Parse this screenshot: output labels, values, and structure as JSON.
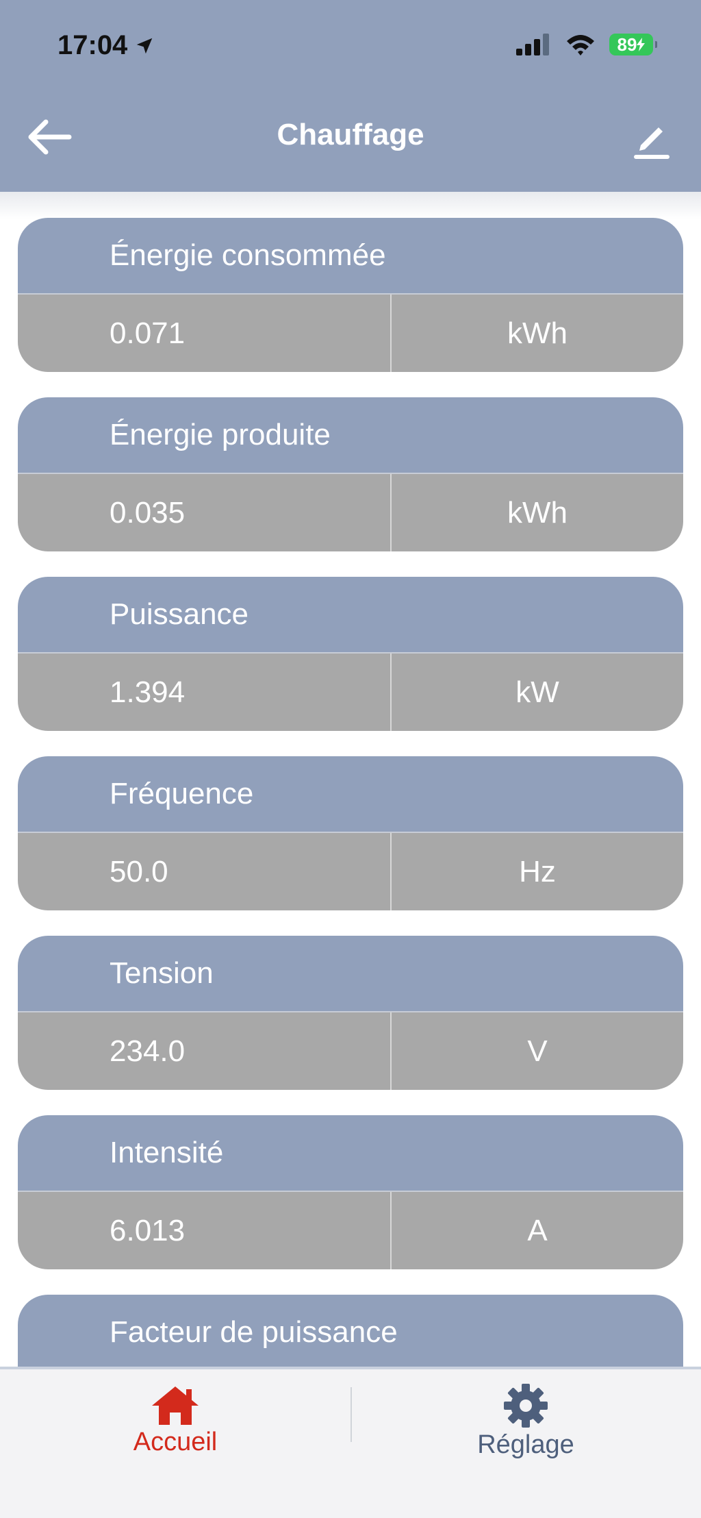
{
  "status": {
    "time": "17:04",
    "battery": "89"
  },
  "nav": {
    "title": "Chauffage"
  },
  "metrics": [
    {
      "label": "Énergie consommée",
      "value": "0.071",
      "unit": "kWh"
    },
    {
      "label": "Énergie produite",
      "value": "0.035",
      "unit": "kWh"
    },
    {
      "label": "Puissance",
      "value": "1.394",
      "unit": "kW"
    },
    {
      "label": "Fréquence",
      "value": "50.0",
      "unit": "Hz"
    },
    {
      "label": "Tension",
      "value": "234.0",
      "unit": "V"
    },
    {
      "label": "Intensité",
      "value": "6.013",
      "unit": "A"
    },
    {
      "label": "Facteur de puissance"
    }
  ],
  "tabs": {
    "home": "Accueil",
    "settings": "Réglage"
  },
  "colors": {
    "header": "#91a0bb",
    "card_value": "#a8a8a8",
    "home_active": "#d32a1c",
    "settings_inactive": "#4e5f7c"
  }
}
